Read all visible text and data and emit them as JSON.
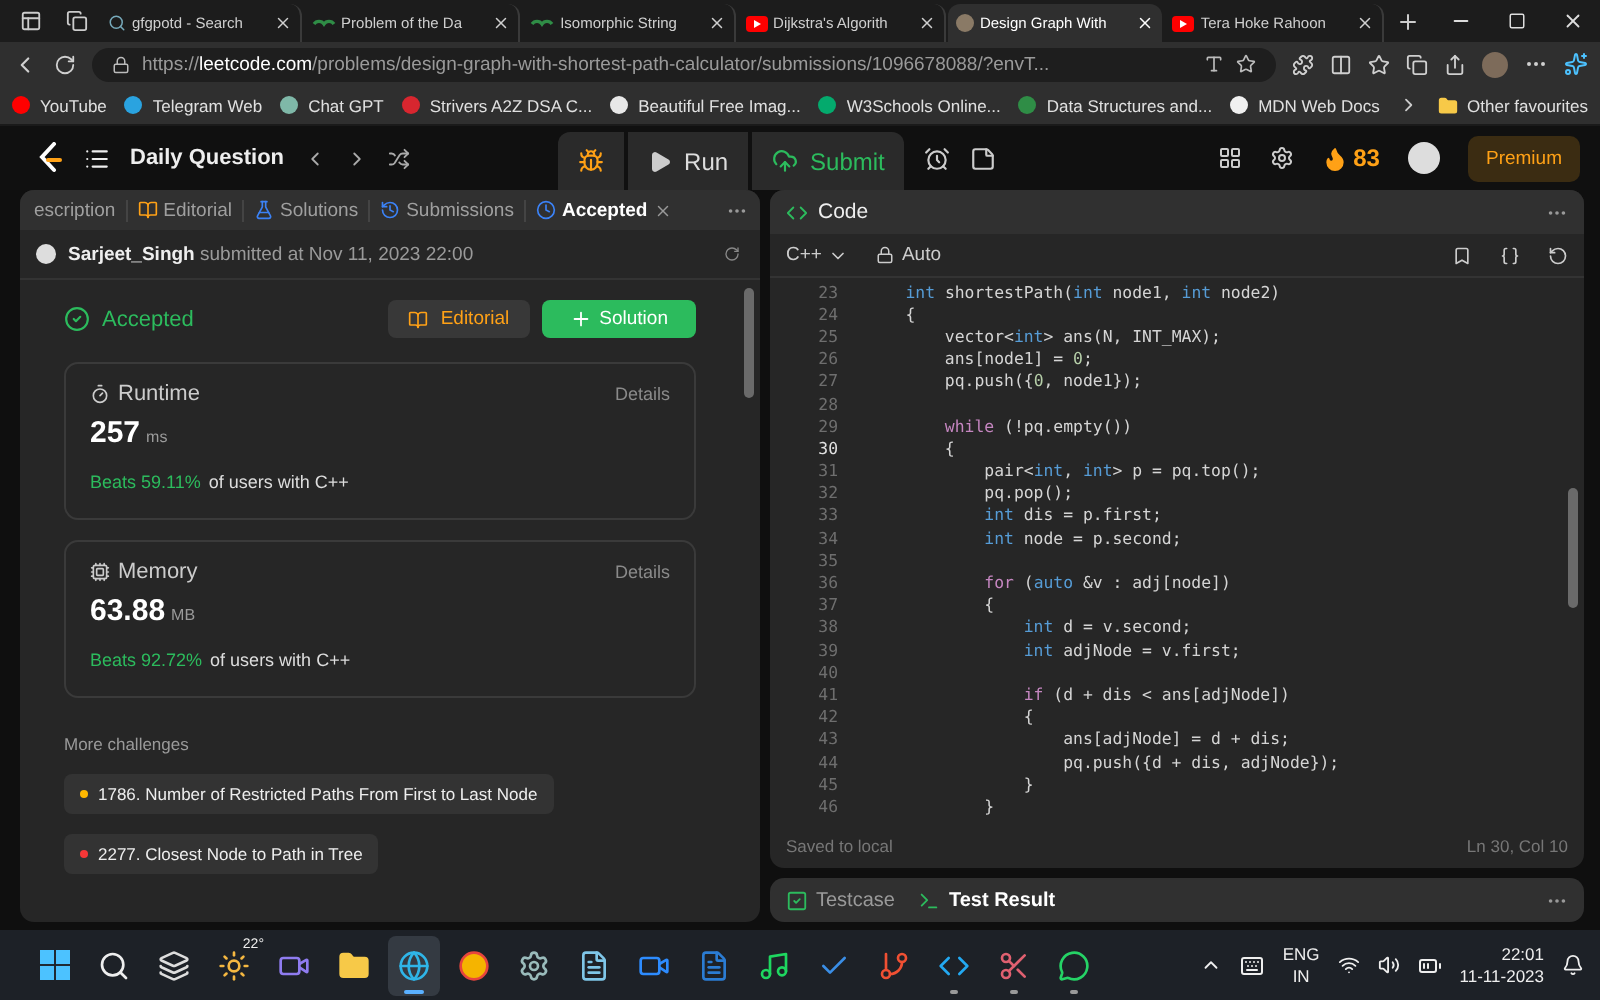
{
  "browser": {
    "tabs": [
      {
        "label": "gfgpotd - Search",
        "kind": "search",
        "selected": false
      },
      {
        "label": "Problem of the Da",
        "kind": "gfg",
        "selected": false
      },
      {
        "label": "Isomorphic String",
        "kind": "gfg",
        "selected": false
      },
      {
        "label": "Dijkstra's Algorith",
        "kind": "video",
        "selected": false
      },
      {
        "label": "Design Graph With",
        "kind": "avatar",
        "selected": true
      },
      {
        "label": "Tera Hoke Rahoon",
        "kind": "video",
        "selected": false
      }
    ],
    "address": {
      "scheme": "https://",
      "host": "leetcode.com",
      "path": "/problems/design-graph-with-shortest-path-calculator/submissions/1096678088/?envT..."
    },
    "bookmarks": [
      {
        "label": "YouTube",
        "color": "#ff0000"
      },
      {
        "label": "Telegram Web",
        "color": "#2aa3e0"
      },
      {
        "label": "Chat GPT",
        "color": "#7fb8a8"
      },
      {
        "label": "Strivers A2Z DSA C...",
        "color": "#d8262f"
      },
      {
        "label": "Beautiful Free Imag...",
        "color": "#e8e8e8"
      },
      {
        "label": "W3Schools Online...",
        "color": "#04aa6d"
      },
      {
        "label": "Data Structures and...",
        "color": "#2f8d46"
      },
      {
        "label": "MDN Web Docs",
        "color": "#f0f0f0"
      }
    ],
    "other_favourites": "Other favourites"
  },
  "nav": {
    "title": "Daily Question",
    "run": "Run",
    "submit": "Submit",
    "streak": "83",
    "premium": "Premium"
  },
  "left_panel": {
    "tabs": [
      {
        "label": "escription",
        "selected": false,
        "closable": false
      },
      {
        "label": "Editorial",
        "selected": false,
        "closable": false
      },
      {
        "label": "Solutions",
        "selected": false,
        "closable": false
      },
      {
        "label": "Submissions",
        "selected": false,
        "closable": false
      },
      {
        "label": "Accepted",
        "selected": true,
        "closable": true
      }
    ],
    "submission": {
      "user": "Sarjeet_Singh",
      "submitted": "submitted at Nov 11, 2023 22:00"
    },
    "status": "Accepted",
    "editorial_button": "Editorial",
    "solution_button": "Solution",
    "stats": [
      {
        "kind": "runtime",
        "title": "Runtime",
        "details": "Details",
        "value": "257",
        "unit": "ms",
        "beats": "Beats 59.11%",
        "suffix": "of users with C++"
      },
      {
        "kind": "memory",
        "title": "Memory",
        "details": "Details",
        "value": "63.88",
        "unit": "MB",
        "beats": "Beats 92.72%",
        "suffix": "of users with C++"
      }
    ],
    "more_challenges": {
      "heading": "More challenges",
      "items": [
        {
          "title": "1786. Number of Restricted Paths From First to Last Node",
          "color": "#ffb800"
        },
        {
          "title": "2277. Closest Node to Path in Tree",
          "color": "#f63737"
        }
      ]
    }
  },
  "code_panel": {
    "title": "Code",
    "language": "C++",
    "mode": "Auto",
    "lines": [
      {
        "number": "23",
        "selected": false,
        "tokens": [
          {
            "text": "    int",
            "kind": "kw"
          },
          {
            "text": " shortestPath(",
            "kind": "plain"
          },
          {
            "text": "int",
            "kind": "kw"
          },
          {
            "text": " node1, ",
            "kind": "plain"
          },
          {
            "text": "int",
            "kind": "kw"
          },
          {
            "text": " node2)",
            "kind": "plain"
          }
        ]
      },
      {
        "number": "24",
        "selected": false,
        "tokens": [
          {
            "text": "    {",
            "kind": "plain"
          }
        ]
      },
      {
        "number": "25",
        "selected": false,
        "tokens": [
          {
            "text": "        vector<",
            "kind": "plain"
          },
          {
            "text": "int",
            "kind": "kw"
          },
          {
            "text": "> ans(N, INT_MAX);",
            "kind": "plain"
          }
        ]
      },
      {
        "number": "26",
        "selected": false,
        "tokens": [
          {
            "text": "        ans[node1] = ",
            "kind": "plain"
          },
          {
            "text": "0",
            "kind": "num"
          },
          {
            "text": ";",
            "kind": "plain"
          }
        ]
      },
      {
        "number": "27",
        "selected": false,
        "tokens": [
          {
            "text": "        pq.push({",
            "kind": "plain"
          },
          {
            "text": "0",
            "kind": "num"
          },
          {
            "text": ", node1});",
            "kind": "plain"
          }
        ]
      },
      {
        "number": "28",
        "selected": false
      },
      {
        "number": "29",
        "selected": false,
        "tokens": [
          {
            "text": "        while",
            "kind": "ctrl"
          },
          {
            "text": " (!pq.empty())",
            "kind": "plain"
          }
        ]
      },
      {
        "number": "30",
        "selected": true,
        "tokens": [
          {
            "text": "        {",
            "kind": "plain"
          }
        ]
      },
      {
        "number": "31",
        "selected": false,
        "tokens": [
          {
            "text": "            pair<",
            "kind": "plain"
          },
          {
            "text": "int",
            "kind": "kw"
          },
          {
            "text": ", ",
            "kind": "plain"
          },
          {
            "text": "int",
            "kind": "kw"
          },
          {
            "text": "> p = pq.top();",
            "kind": "plain"
          }
        ]
      },
      {
        "number": "32",
        "selected": false,
        "tokens": [
          {
            "text": "            pq.pop();",
            "kind": "plain"
          }
        ]
      },
      {
        "number": "33",
        "selected": false,
        "tokens": [
          {
            "text": "            int",
            "kind": "kw"
          },
          {
            "text": " dis = p.first;",
            "kind": "plain"
          }
        ]
      },
      {
        "number": "34",
        "selected": false,
        "tokens": [
          {
            "text": "            int",
            "kind": "kw"
          },
          {
            "text": " node = p.second;",
            "kind": "plain"
          }
        ]
      },
      {
        "number": "35",
        "selected": false
      },
      {
        "number": "36",
        "selected": false,
        "tokens": [
          {
            "text": "            for",
            "kind": "ctrl"
          },
          {
            "text": " (",
            "kind": "plain"
          },
          {
            "text": "auto",
            "kind": "kw"
          },
          {
            "text": " &v : adj[node])",
            "kind": "plain"
          }
        ]
      },
      {
        "number": "37",
        "selected": false,
        "tokens": [
          {
            "text": "            {",
            "kind": "plain"
          }
        ]
      },
      {
        "number": "38",
        "selected": false,
        "tokens": [
          {
            "text": "                int",
            "kind": "kw"
          },
          {
            "text": " d = v.second;",
            "kind": "plain"
          }
        ]
      },
      {
        "number": "39",
        "selected": false,
        "tokens": [
          {
            "text": "                int",
            "kind": "kw"
          },
          {
            "text": " adjNode = v.first;",
            "kind": "plain"
          }
        ]
      },
      {
        "number": "40",
        "selected": false
      },
      {
        "number": "41",
        "selected": false,
        "tokens": [
          {
            "text": "                if",
            "kind": "ctrl"
          },
          {
            "text": " (d + dis < ans[adjNode])",
            "kind": "plain"
          }
        ]
      },
      {
        "number": "42",
        "selected": false,
        "tokens": [
          {
            "text": "                {",
            "kind": "plain"
          }
        ]
      },
      {
        "number": "43",
        "selected": false,
        "tokens": [
          {
            "text": "                    ans[adjNode] = d + dis;",
            "kind": "plain"
          }
        ]
      },
      {
        "number": "44",
        "selected": false,
        "tokens": [
          {
            "text": "                    pq.push({d + dis, adjNode});",
            "kind": "plain"
          }
        ]
      },
      {
        "number": "45",
        "selected": false,
        "tokens": [
          {
            "text": "                }",
            "kind": "plain"
          }
        ]
      },
      {
        "number": "46",
        "selected": false,
        "tokens": [
          {
            "text": "            }",
            "kind": "plain"
          }
        ]
      }
    ],
    "saved": "Saved to local",
    "position": "Ln 30, Col 10"
  },
  "bottom_panel": {
    "tabs": [
      {
        "label": "Testcase",
        "selected": false
      },
      {
        "label": "Test Result",
        "selected": true
      }
    ]
  },
  "taskbar": {
    "apps": [
      {
        "kind": "start",
        "running": false,
        "selected": false
      },
      {
        "kind": "search",
        "running": false,
        "selected": false
      },
      {
        "kind": "taskview",
        "running": false,
        "selected": false
      },
      {
        "kind": "weather",
        "label": "22°",
        "running": false,
        "selected": false
      },
      {
        "kind": "meet",
        "running": false,
        "selected": false
      },
      {
        "kind": "files",
        "running": false,
        "selected": false
      },
      {
        "kind": "edge",
        "running": true,
        "selected": true
      },
      {
        "kind": "chrome",
        "running": false,
        "selected": false
      },
      {
        "kind": "settings",
        "running": false,
        "selected": false
      },
      {
        "kind": "notepad",
        "running": false,
        "selected": false
      },
      {
        "kind": "zoom",
        "running": false,
        "selected": false
      },
      {
        "kind": "word",
        "running": false,
        "selected": false
      },
      {
        "kind": "spotify",
        "running": false,
        "selected": false
      },
      {
        "kind": "todo",
        "running": false,
        "selected": false
      },
      {
        "kind": "git",
        "running": false,
        "selected": false
      },
      {
        "kind": "vscode",
        "running": true,
        "selected": false
      },
      {
        "kind": "snipping",
        "running": true,
        "selected": false
      },
      {
        "kind": "whatsapp",
        "running": true,
        "selected": false
      }
    ],
    "language": "ENG",
    "region": "IN",
    "time": "22:01",
    "date": "11-11-2023"
  }
}
